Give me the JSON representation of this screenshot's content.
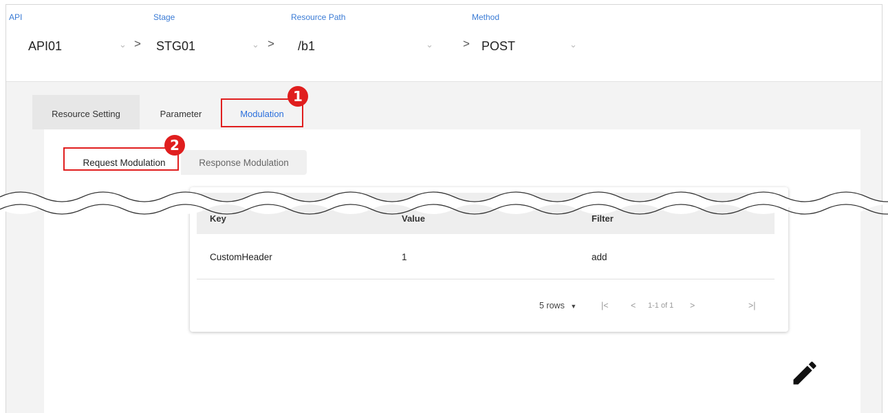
{
  "breadcrumbs": [
    {
      "label": "API",
      "value": "API01"
    },
    {
      "label": "Stage",
      "value": "STG01"
    },
    {
      "label": "Resource Path",
      "value": "/b1"
    },
    {
      "label": "Method",
      "value": "POST"
    }
  ],
  "separator": ">",
  "chevron": "⌄",
  "tabs": [
    "Resource Setting",
    "Parameter",
    "Modulation"
  ],
  "active_tab": "Modulation",
  "sub_tabs": [
    "Request Modulation",
    "Response Modulation"
  ],
  "active_sub_tab": "Request Modulation",
  "callouts": [
    "1",
    "2"
  ],
  "table": {
    "headers": [
      "Key",
      "Value",
      "Filter"
    ],
    "rows": [
      {
        "key": "CustomHeader",
        "value": "1",
        "filter": "add"
      }
    ]
  },
  "pagination": {
    "rows_per_page": "5 rows",
    "range": "1-1 of 1",
    "first": "|<",
    "prev": "<",
    "next": ">",
    "last": ">|"
  },
  "colors": {
    "accent": "#2b6fdc",
    "highlight": "#e01e1e"
  },
  "icons": [
    "chevron-down-icon",
    "pencil-edit-icon",
    "dropdown-caret-icon"
  ]
}
